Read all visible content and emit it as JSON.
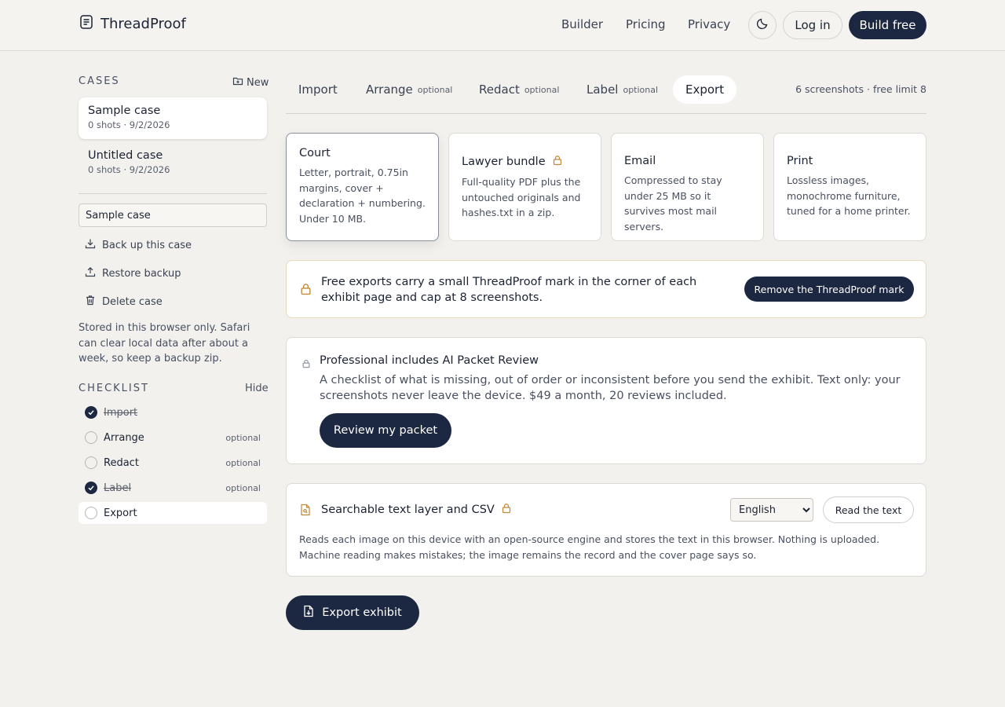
{
  "header": {
    "app_name": "ThreadProof",
    "nav": [
      "Builder",
      "Pricing",
      "Privacy"
    ],
    "login_label": "Log in",
    "build_label": "Build free"
  },
  "sidebar": {
    "cases_heading": "CASES",
    "new_label": "New",
    "cases": [
      {
        "title": "Sample case",
        "meta": "0 shots · 9/2/2026"
      },
      {
        "title": "Untitled case",
        "meta": "0 shots · 9/2/2026"
      }
    ],
    "case_name_value": "Sample case",
    "actions": [
      "Back up this case",
      "Restore backup",
      "Delete case"
    ],
    "storage_note": "Stored in this browser only. Safari can clear local data after about a week, so keep a backup zip.",
    "checklist_heading": "CHECKLIST",
    "hide_label": "Hide",
    "checklist": [
      {
        "label": "Import",
        "done": true,
        "optional": ""
      },
      {
        "label": "Arrange",
        "done": false,
        "optional": "optional"
      },
      {
        "label": "Redact",
        "done": false,
        "optional": "optional"
      },
      {
        "label": "Label",
        "done": true,
        "optional": "optional"
      },
      {
        "label": "Export",
        "done": false,
        "optional": ""
      }
    ]
  },
  "tabs": [
    {
      "label": "Import",
      "optional": ""
    },
    {
      "label": "Arrange",
      "optional": "optional"
    },
    {
      "label": "Redact",
      "optional": "optional"
    },
    {
      "label": "Label",
      "optional": "optional"
    },
    {
      "label": "Export",
      "optional": ""
    }
  ],
  "shots_count": "6 screenshots · free limit 8",
  "formats": [
    {
      "title": "Court",
      "desc": "Letter, portrait, 0.75in margins, cover + declaration + numbering. Under 10 MB."
    },
    {
      "title": "Lawyer bundle",
      "desc": "Full-quality PDF plus the untouched originals and hashes.txt in a zip."
    },
    {
      "title": "Email",
      "desc": "Compressed to stay under 25 MB so it survives most mail servers."
    },
    {
      "title": "Print",
      "desc": "Lossless images, monochrome furniture, tuned for a home printer."
    }
  ],
  "watermark_notice": {
    "text": "Free exports carry a small ThreadProof mark in the corner of each exhibit page and cap at 8 screenshots.",
    "button": "Remove the ThreadProof mark"
  },
  "ai_review": {
    "title": "Professional includes AI Packet Review",
    "desc": "A checklist of what is missing, out of order or inconsistent before you send the exhibit. Text only: your screenshots never leave the device. $49 a month, 20 reviews included.",
    "button": "Review my packet"
  },
  "ocr": {
    "title": "Searchable text layer and CSV",
    "language": "English",
    "button": "Read the text",
    "desc": "Reads each image on this device with an open-source engine and stores the text in this browser. Nothing is uploaded. Machine reading makes mistakes; the image remains the record and the cover page says so."
  },
  "export_label": "Export exhibit",
  "colors": {
    "accent": "#1c2742",
    "lock": "#c08a3a",
    "background": "#f2f1ee"
  }
}
